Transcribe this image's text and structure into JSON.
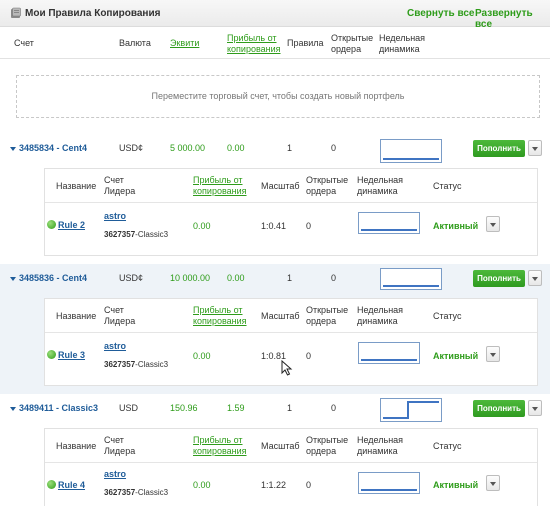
{
  "header": {
    "title": "Мои Правила Копирования",
    "collapse_all": "Свернуть все",
    "expand_all": "Развернуть все"
  },
  "columns": {
    "account": "Счет",
    "currency": "Валюта",
    "equity": "Эквити",
    "profit_line1": "Прибыль от",
    "profit_line2": "копирования",
    "rules": "Правила",
    "open_line1": "Открытые",
    "open_line2": "ордера",
    "weekly_line1": "Недельная",
    "weekly_line2": "динамика"
  },
  "dropzone": "Переместите торговый счет, чтобы создать новый портфель",
  "sub_columns": {
    "name": "Название",
    "leader_line1": "Счет",
    "leader_line2": "Лидера",
    "profit_line1": "Прибыль от",
    "profit_line2": "копирования",
    "scale": "Масштаб",
    "open_line1": "Открытые",
    "open_line2": "ордера",
    "weekly_line1": "Недельная",
    "weekly_line2": "динамика",
    "status": "Статус"
  },
  "fund_button": "Пополнить",
  "accounts": [
    {
      "name": "3485834 - Cent4",
      "currency": "USD¢",
      "equity": "5 000.00",
      "profit": "0.00",
      "rules": "1",
      "open": "0",
      "rule": {
        "name": "Rule 2",
        "leader": "astro",
        "leader_acct": "3627357",
        "leader_type": "-Classic3",
        "profit": "0.00",
        "scale": "1:0.41",
        "open": "0",
        "status": "Активный"
      }
    },
    {
      "name": "3485836 - Cent4",
      "currency": "USD¢",
      "equity": "10 000.00",
      "profit": "0.00",
      "rules": "1",
      "open": "0",
      "rule": {
        "name": "Rule 3",
        "leader": "astro",
        "leader_acct": "3627357",
        "leader_type": "-Classic3",
        "profit": "0.00",
        "scale": "1:0.81",
        "open": "0",
        "status": "Активный"
      }
    },
    {
      "name": "3489411 - Classic3",
      "currency": "USD",
      "equity": "150.96",
      "profit": "1.59",
      "rules": "1",
      "open": "0",
      "rule": {
        "name": "Rule 4",
        "leader": "astro",
        "leader_acct": "3627357",
        "leader_type": "-Classic3",
        "profit": "0.00",
        "scale": "1:1.22",
        "open": "0",
        "status": "Активный"
      }
    }
  ],
  "icons": {
    "title": "book-icon",
    "collapse": "caret-down-icon",
    "rule_status": "green-dot-icon",
    "menu": "dropdown-arrow-icon",
    "pointer": "mouse-cursor-icon"
  },
  "colors": {
    "accent_green": "#2e9c1a",
    "link_blue": "#1f5c99",
    "spark_blue": "#3f74c2",
    "alt_row": "#eef3f8"
  }
}
